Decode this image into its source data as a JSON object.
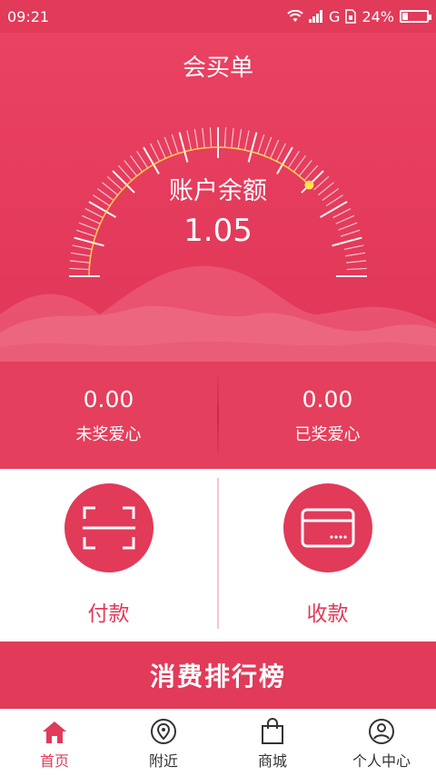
{
  "status_bar": {
    "time": "09:21",
    "network": "G",
    "battery_text": "24%",
    "battery_level": 0.24,
    "icons": [
      "wifi-icon",
      "signal-icon",
      "sim-icon",
      "battery-icon"
    ]
  },
  "header": {
    "title": "会买单"
  },
  "account": {
    "balance_label": "账户余额",
    "balance_value": "1.05"
  },
  "stats": [
    {
      "value": "0.00",
      "label": "未奖爱心"
    },
    {
      "value": "0.00",
      "label": "已奖爱心"
    }
  ],
  "actions": [
    {
      "label": "付款",
      "icon": "scan-icon"
    },
    {
      "label": "收款",
      "icon": "card-icon"
    }
  ],
  "ranking": {
    "label": "消费排行榜"
  },
  "tabbar": [
    {
      "label": "首页",
      "icon": "home-icon",
      "active": true
    },
    {
      "label": "附近",
      "icon": "location-pin-icon",
      "active": false
    },
    {
      "label": "商城",
      "icon": "shopping-bag-icon",
      "active": false
    },
    {
      "label": "个人中心",
      "icon": "user-icon",
      "active": false
    }
  ],
  "colors": {
    "accent": "#e23a59",
    "gauge_highlight": "#ffe34d",
    "divider": "#f4c6cf"
  }
}
